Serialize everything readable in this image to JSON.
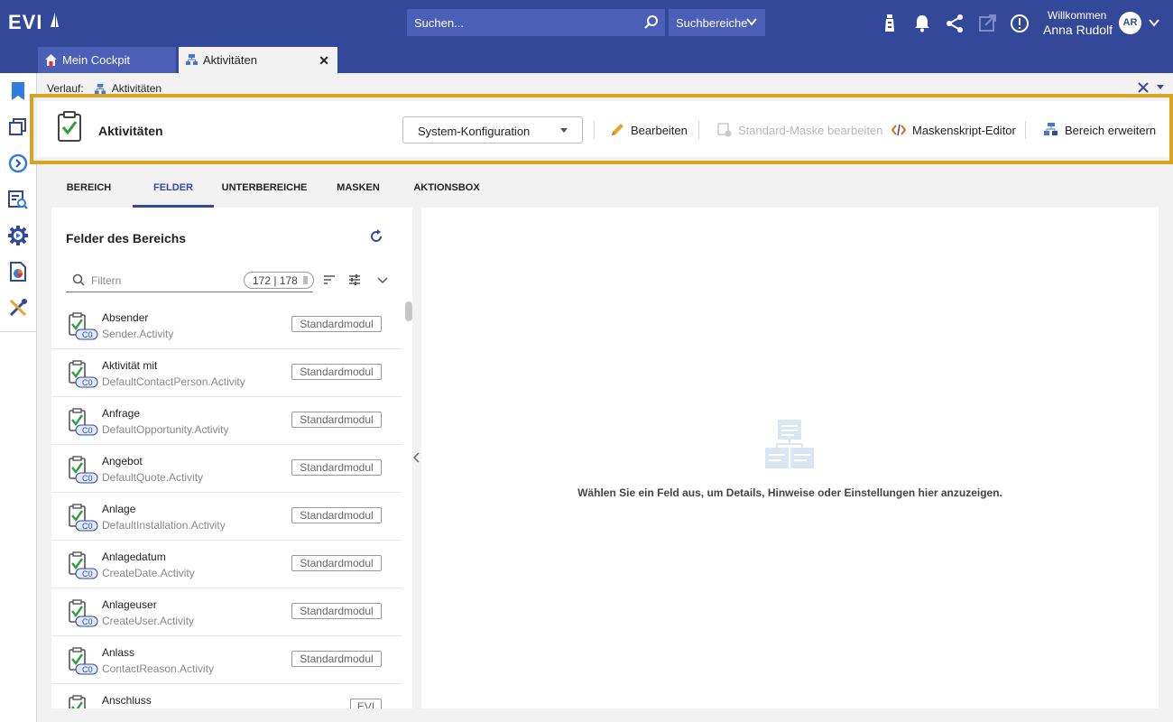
{
  "app": {
    "logo": "EVI"
  },
  "header": {
    "search_placeholder": "Suchen...",
    "search_scope": "Suchbereiche",
    "welcome": "Willkommen",
    "user_name": "Anna Rudolf",
    "avatar_initials": "AR"
  },
  "tabs": [
    {
      "label": "Mein Cockpit"
    },
    {
      "label": "Aktivitäten"
    }
  ],
  "breadcrumb": {
    "prefix": "Verlauf:",
    "item": "Aktivitäten"
  },
  "toolbar": {
    "title": "Aktivitäten",
    "config_select": "System-Konfiguration",
    "edit": "Bearbeiten",
    "edit_standard_mask": "Standard-Maske bearbeiten",
    "mask_script_editor": "Maskenskript-Editor",
    "extend_area": "Bereich erweitern"
  },
  "subtabs": [
    "BEREICH",
    "FELDER",
    "UNTERBEREICHE",
    "MASKEN",
    "AKTIONSBOX"
  ],
  "fields_panel": {
    "title": "Felder des Bereichs",
    "filter_placeholder": "Filtern",
    "count": "172 | 178",
    "items": [
      {
        "name": "Absender",
        "technical": "Sender.Activity",
        "badge": "Standardmodul",
        "tag": "C0"
      },
      {
        "name": "Aktivität mit",
        "technical": "DefaultContactPerson.Activity",
        "badge": "Standardmodul",
        "tag": "C0"
      },
      {
        "name": "Anfrage",
        "technical": "DefaultOpportunity.Activity",
        "badge": "Standardmodul",
        "tag": "C0"
      },
      {
        "name": "Angebot",
        "technical": "DefaultQuote.Activity",
        "badge": "Standardmodul",
        "tag": "C0"
      },
      {
        "name": "Anlage",
        "technical": "DefaultInstallation.Activity",
        "badge": "Standardmodul",
        "tag": "C0"
      },
      {
        "name": "Anlagedatum",
        "technical": "CreateDate.Activity",
        "badge": "Standardmodul",
        "tag": "C0"
      },
      {
        "name": "Anlageuser",
        "technical": "CreateUser.Activity",
        "badge": "Standardmodul",
        "tag": "C0"
      },
      {
        "name": "Anlass",
        "technical": "ContactReason.Activity",
        "badge": "Standardmodul",
        "tag": "C0"
      },
      {
        "name": "Anschluss",
        "technical": "",
        "badge": "EVI",
        "tag": ""
      }
    ]
  },
  "detail_panel": {
    "empty_message": "Wählen Sie ein Feld aus, um Details, Hinweise oder Einstellungen hier anzuzeigen."
  },
  "colors": {
    "primary": "#34489a",
    "highlight": "#d9a321",
    "check_green": "#2e9e3e"
  }
}
